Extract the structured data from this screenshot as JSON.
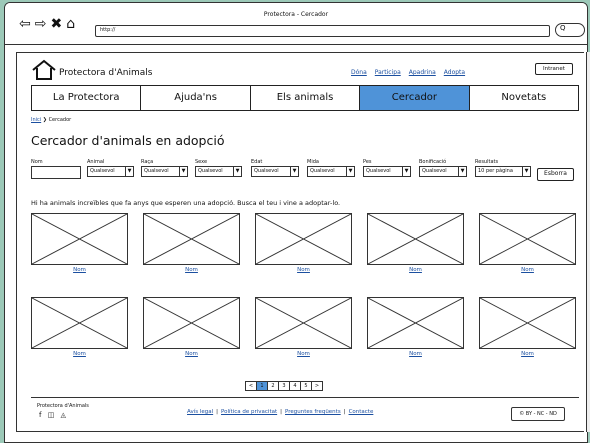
{
  "window": {
    "title": "Protectora - Cercador",
    "url": "http://",
    "search_glyph": "Q"
  },
  "header": {
    "logo_text": "Protectora d'Animals",
    "top_links": [
      "Dóna",
      "Participa",
      "Apadrina",
      "Adopta"
    ],
    "intranet_label": "Intranet"
  },
  "menu": {
    "items": [
      "La Protectora",
      "Ajuda'ns",
      "Els animals",
      "Cercador",
      "Novetats"
    ],
    "active_index": 3
  },
  "breadcrumb": {
    "home": "Inici",
    "sep": "❯",
    "current": "Cercador"
  },
  "page_title": "Cercador d'animals en adopció",
  "filters": {
    "nom_label": "Nom",
    "animal_label": "Animal",
    "animal_value": "Qualsevol",
    "raca_label": "Raça",
    "raca_value": "Qualsevol",
    "sexe_label": "Sexe",
    "sexe_value": "Qualsevol",
    "edat_label": "Edat",
    "edat_value": "Qualsevol",
    "mida_label": "Mida",
    "mida_value": "Qualsevol",
    "pes_label": "Pes",
    "pes_value": "Qualsevol",
    "bonificacio_label": "Bonificació",
    "bonificacio_value": "Qualsevol",
    "resultats_label": "Resultats",
    "resultats_value": "10 per pàgina",
    "clear_button": "Esborra"
  },
  "intro": "Hi ha animals increïbles que fa anys que esperen una adopció. Busca el teu i vine a adoptar-lo.",
  "results": [
    {
      "name": "Nom"
    },
    {
      "name": "Nom"
    },
    {
      "name": "Nom"
    },
    {
      "name": "Nom"
    },
    {
      "name": "Nom"
    },
    {
      "name": "Nom"
    },
    {
      "name": "Nom"
    },
    {
      "name": "Nom"
    },
    {
      "name": "Nom"
    },
    {
      "name": "Nom"
    }
  ],
  "pagination": {
    "prev": "<",
    "pages": [
      "1",
      "2",
      "3",
      "4",
      "5"
    ],
    "current": "1",
    "next": ">"
  },
  "footer": {
    "org": "Protectora d'Animals",
    "social_icons": [
      "facebook-icon",
      "instagram-icon",
      "flickr-icon"
    ],
    "links": [
      "Avís legal",
      "Política de privacitat",
      "Preguntes freqüents",
      "Contacte"
    ],
    "license": "BY - NC - ND"
  }
}
